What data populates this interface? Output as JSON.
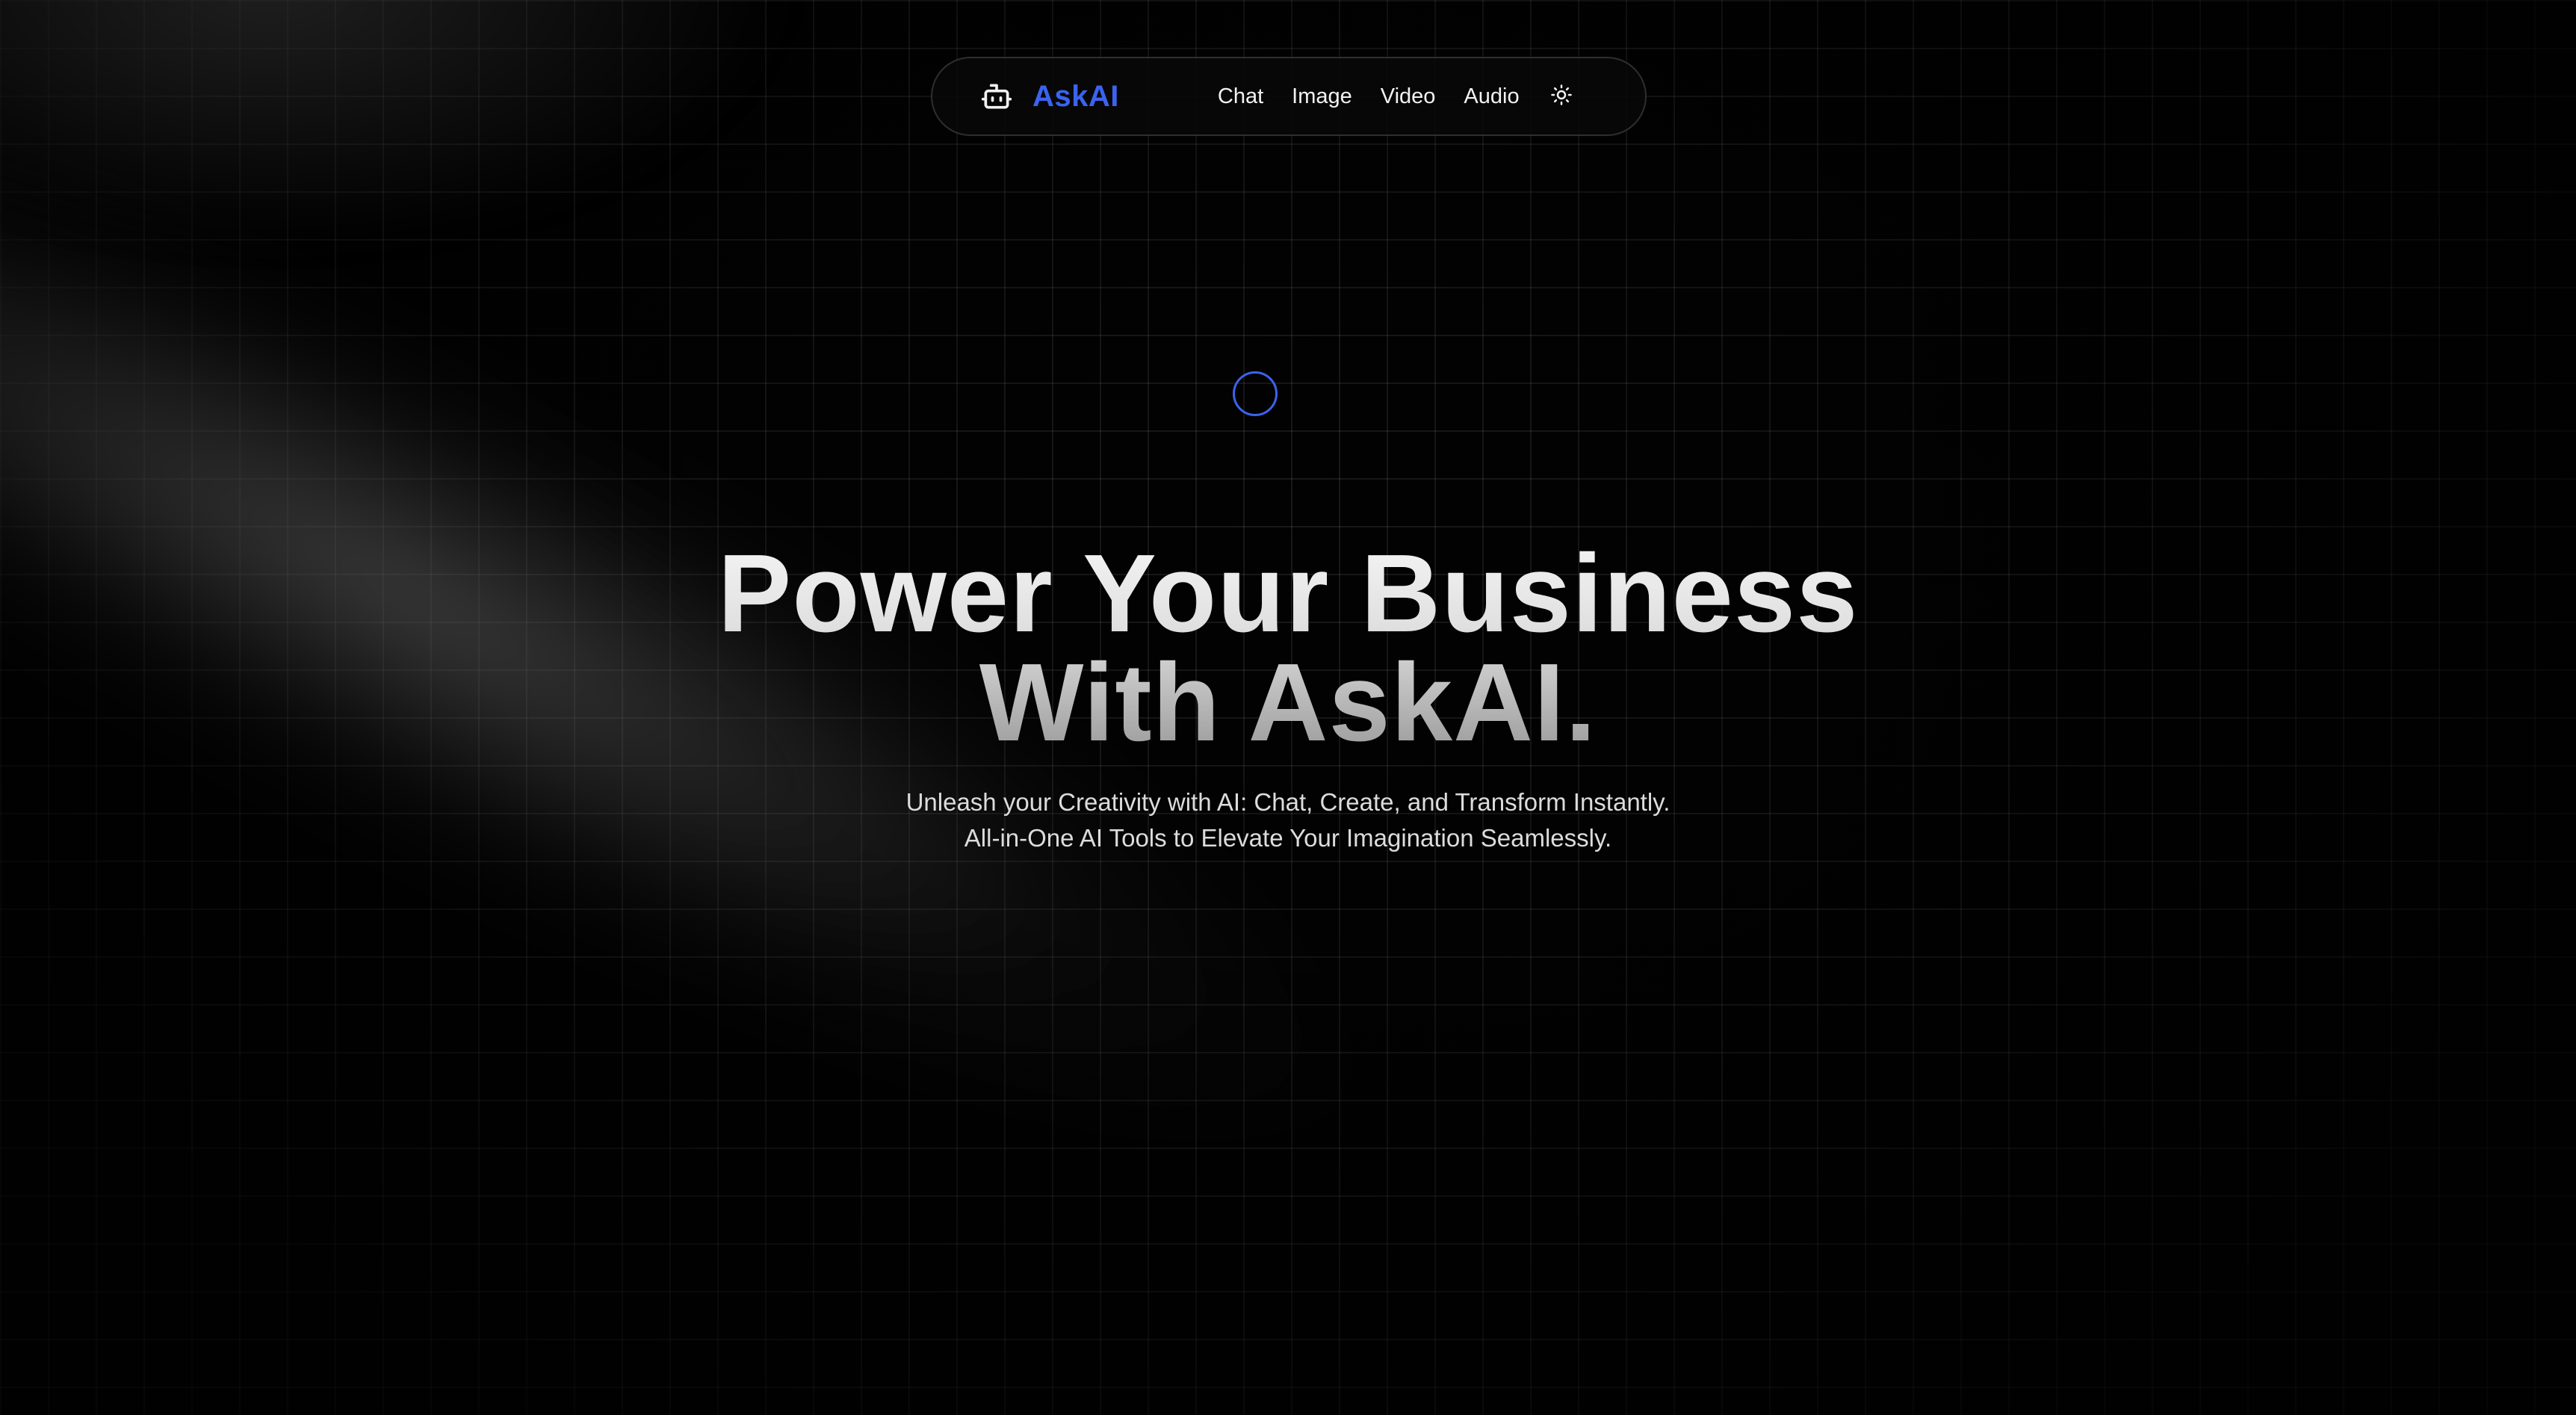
{
  "nav": {
    "brand": "AskAI",
    "links": [
      "Chat",
      "Image",
      "Video",
      "Audio"
    ],
    "brand_icon": "robot-icon",
    "theme_icon": "sun-icon"
  },
  "hero": {
    "title_line1": "Power Your Business",
    "title_line2": "With AskAI.",
    "subtitle_line1": "Unleash your Creativity with AI: Chat, Create, and Transform Instantly.",
    "subtitle_line2": "All-in-One AI Tools to Elevate Your Imagination Seamlessly."
  },
  "colors": {
    "accent": "#3b63ee",
    "background": "#000000",
    "text": "#f2f2f2"
  }
}
